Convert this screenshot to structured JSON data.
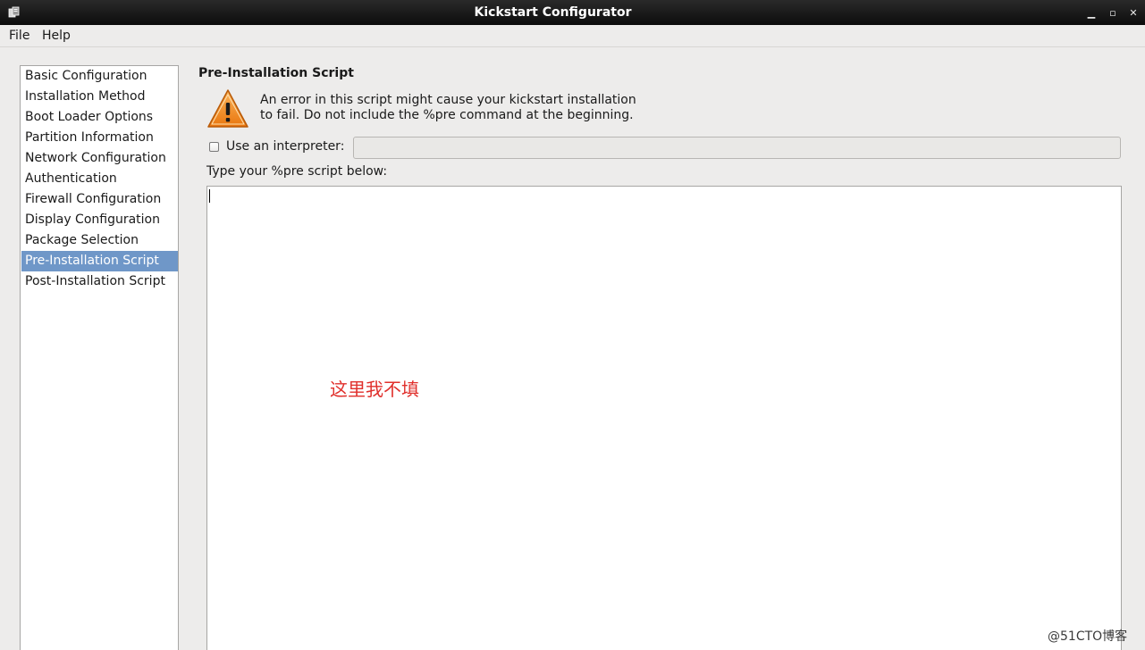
{
  "window": {
    "title": "Kickstart Configurator",
    "controls": {
      "minimize": "▁",
      "maximize": "▫",
      "close": "✕"
    }
  },
  "menu": [
    "File",
    "Help"
  ],
  "sidebar": {
    "items": [
      {
        "label": "Basic Configuration"
      },
      {
        "label": "Installation Method"
      },
      {
        "label": "Boot Loader Options"
      },
      {
        "label": "Partition Information"
      },
      {
        "label": "Network Configuration"
      },
      {
        "label": "Authentication"
      },
      {
        "label": "Firewall Configuration"
      },
      {
        "label": "Display Configuration"
      },
      {
        "label": "Package Selection"
      },
      {
        "label": "Pre-Installation Script"
      },
      {
        "label": "Post-Installation Script"
      }
    ],
    "selected": "Pre-Installation Script"
  },
  "main": {
    "title": "Pre-Installation Script",
    "warning_line1": "An error in this script might cause your kickstart installation",
    "warning_line2": "to fail. Do not include the %pre command at the beginning.",
    "interpreter_label": "Use an interpreter:",
    "interpreter_checked": false,
    "interpreter_value": "",
    "script_label": "Type your %pre script below:",
    "script_value": ""
  },
  "annotation": "这里我不填",
  "watermark": "@51CTO博客",
  "colors": {
    "selection": "#6f97c8",
    "annotation": "#e0302c",
    "warning_orange": "#f08a1c"
  }
}
